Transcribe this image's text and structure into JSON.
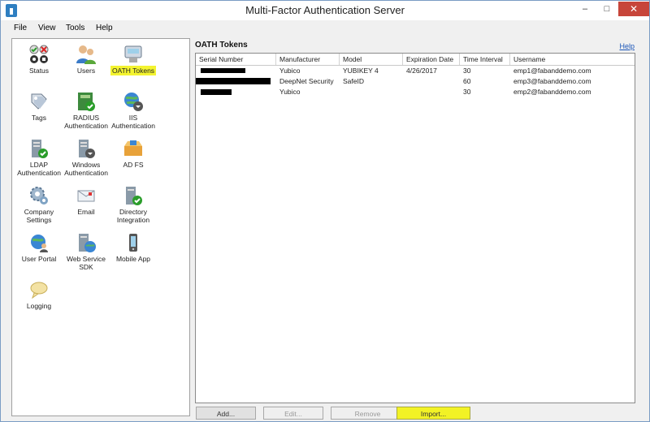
{
  "window": {
    "title": "Multi-Factor Authentication Server",
    "controls": {
      "minimize": "–",
      "maximize": "□",
      "close": "✕"
    }
  },
  "menu": [
    "File",
    "View",
    "Tools",
    "Help"
  ],
  "nav": [
    {
      "label": "Status",
      "icon": "status-icon"
    },
    {
      "label": "Users",
      "icon": "users-icon"
    },
    {
      "label": "OATH Tokens",
      "icon": "oath-tokens-icon",
      "selected": true
    },
    {
      "label": "Tags",
      "icon": "tags-icon"
    },
    {
      "label": "RADIUS Authentication",
      "icon": "radius-icon"
    },
    {
      "label": "IIS Authentication",
      "icon": "iis-icon"
    },
    {
      "label": "LDAP Authentication",
      "icon": "ldap-icon"
    },
    {
      "label": "Windows Authentication",
      "icon": "windows-auth-icon"
    },
    {
      "label": "AD FS",
      "icon": "adfs-icon"
    },
    {
      "label": "Company Settings",
      "icon": "company-settings-icon"
    },
    {
      "label": "Email",
      "icon": "email-icon"
    },
    {
      "label": "Directory Integration",
      "icon": "directory-integration-icon"
    },
    {
      "label": "User Portal",
      "icon": "user-portal-icon"
    },
    {
      "label": "Web Service SDK",
      "icon": "web-service-sdk-icon"
    },
    {
      "label": "Mobile App",
      "icon": "mobile-app-icon"
    },
    {
      "label": "Logging",
      "icon": "logging-icon"
    }
  ],
  "panel": {
    "title": "OATH Tokens",
    "help": "Help"
  },
  "table": {
    "columns": [
      "Serial Number",
      "Manufacturer",
      "Model",
      "Expiration Date",
      "Time Interval",
      "Username"
    ],
    "rows": [
      {
        "serial": "",
        "manufacturer": "Yubico",
        "model": "YUBIKEY 4",
        "expiration": "4/26/2017",
        "interval": "30",
        "username": "emp1@fabanddemo.com"
      },
      {
        "serial": "",
        "manufacturer": "DeepNet Security",
        "model": "SafeID",
        "expiration": "",
        "interval": "60",
        "username": "emp3@fabanddemo.com"
      },
      {
        "serial": "",
        "manufacturer": "Yubico",
        "model": "",
        "expiration": "",
        "interval": "30",
        "username": "emp2@fabanddemo.com"
      }
    ]
  },
  "buttons": {
    "add": "Add...",
    "edit": "Edit...",
    "remove": "Remove",
    "import": "Import..."
  },
  "colors": {
    "highlight": "#f4f430",
    "close": "#c7453a",
    "link": "#1a55b8"
  }
}
